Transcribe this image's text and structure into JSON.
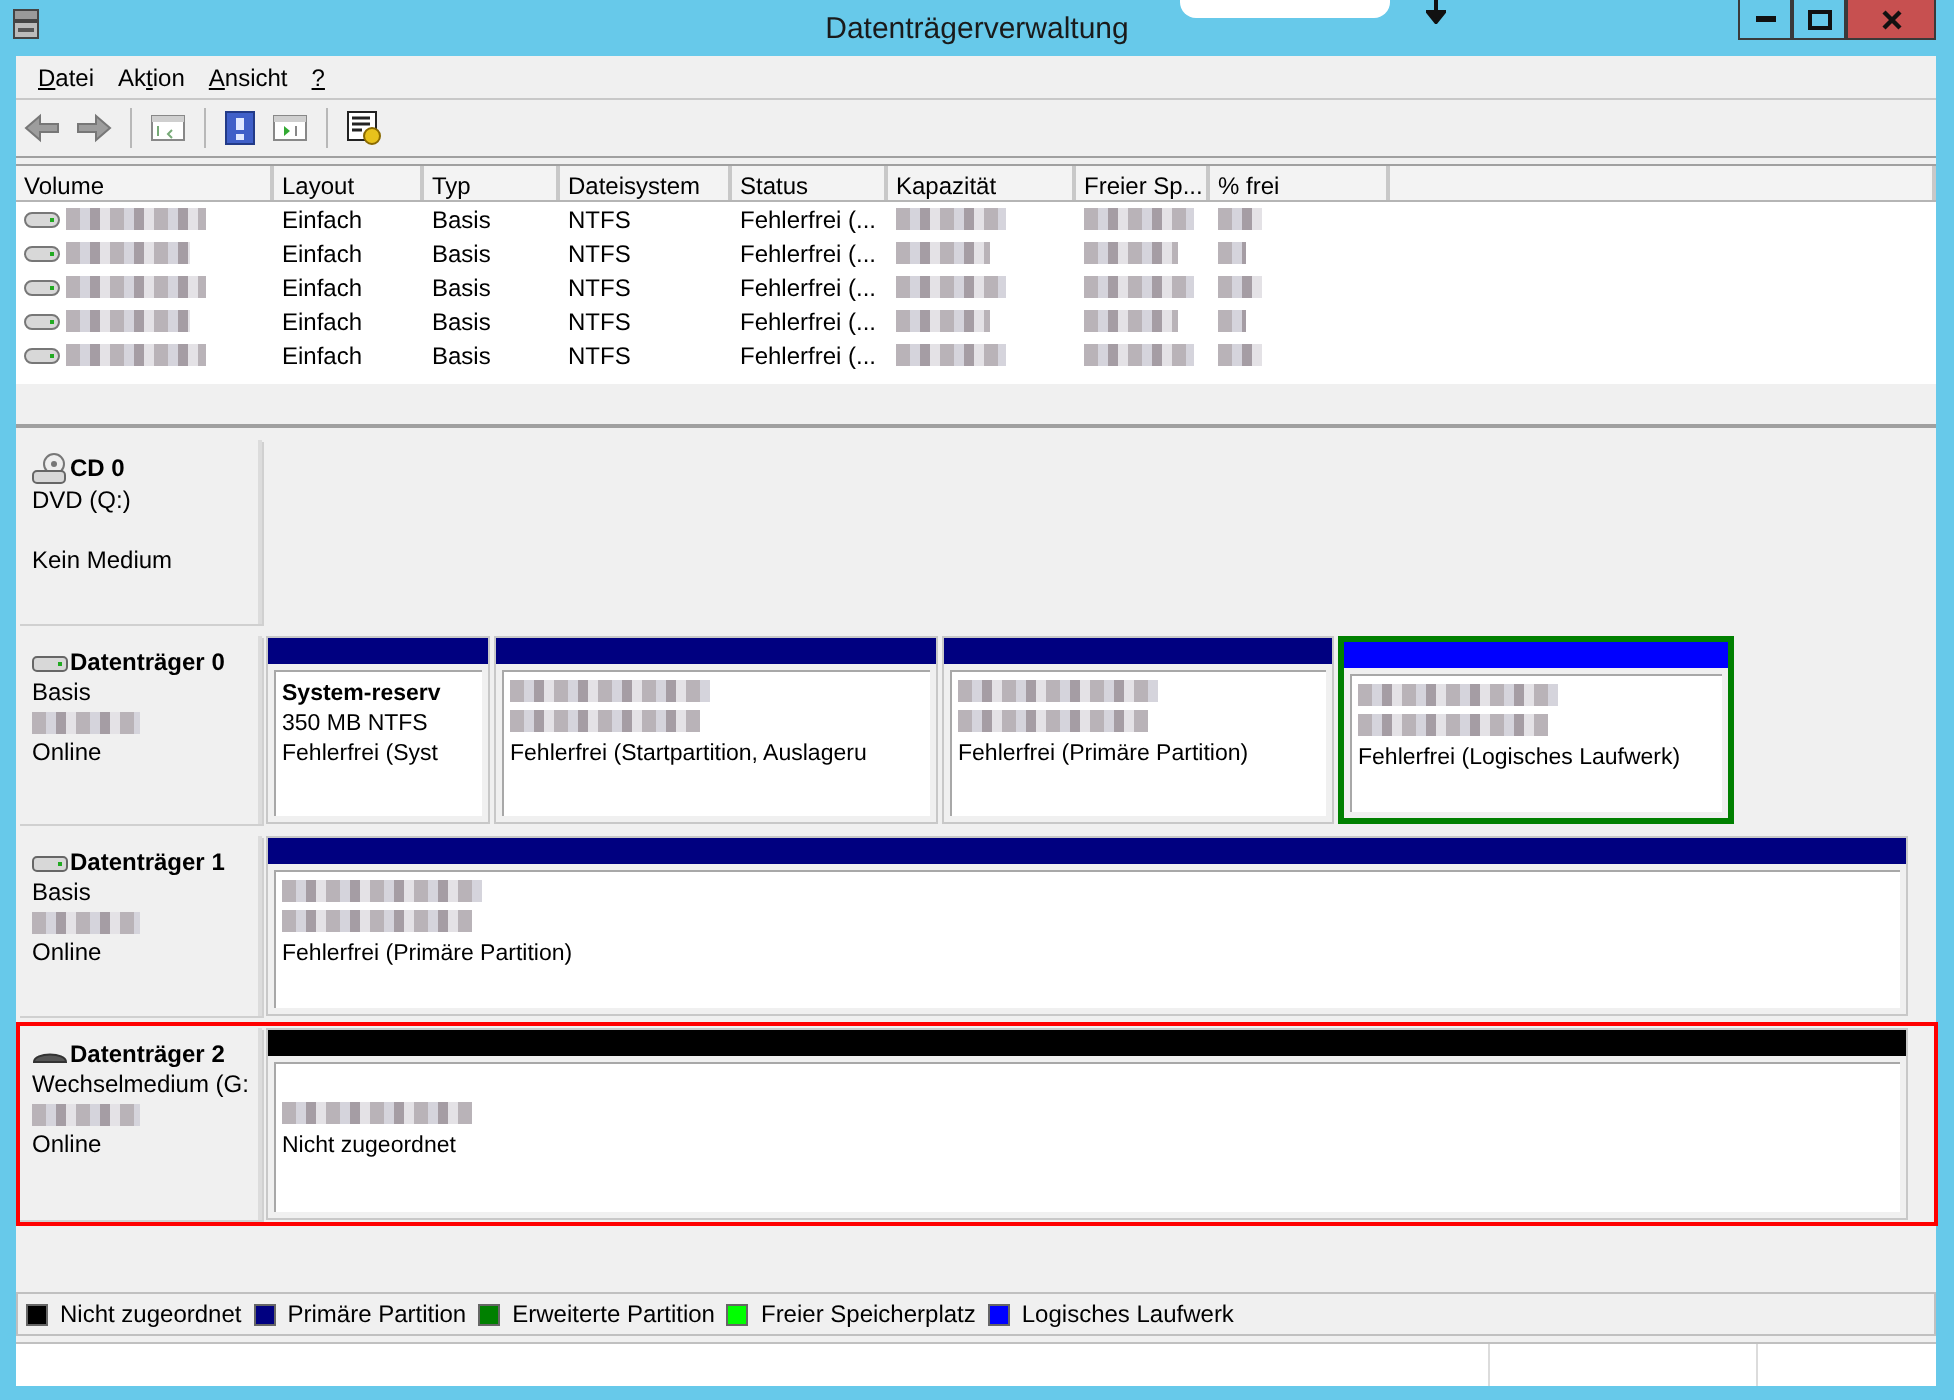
{
  "window": {
    "title": "Datenträgerverwaltung"
  },
  "menu": [
    {
      "accel": "D",
      "after": "atei"
    },
    {
      "before": "Ak",
      "accel": "t",
      "after": "ion"
    },
    {
      "accel": "A",
      "after": "nsicht"
    },
    {
      "accel": "?"
    }
  ],
  "volume_table": {
    "columns": [
      "Volume",
      "Layout",
      "Typ",
      "Dateisystem",
      "Status",
      "Kapazität",
      "Freier Sp...",
      "% frei"
    ],
    "rows": [
      {
        "cells": [
          {
            "kind": "redacted"
          },
          "Einfach",
          "Basis",
          "NTFS",
          "Fehlerfrei (...",
          {
            "kind": "redacted"
          },
          {
            "kind": "redacted"
          },
          {
            "kind": "redacted"
          }
        ]
      },
      {
        "cells": [
          {
            "kind": "redacted"
          },
          "Einfach",
          "Basis",
          "NTFS",
          "Fehlerfrei (...",
          {
            "kind": "redacted"
          },
          {
            "kind": "redacted"
          },
          {
            "kind": "redacted"
          }
        ]
      },
      {
        "cells": [
          {
            "kind": "redacted"
          },
          "Einfach",
          "Basis",
          "NTFS",
          "Fehlerfrei (...",
          {
            "kind": "redacted"
          },
          {
            "kind": "redacted"
          },
          {
            "kind": "redacted"
          }
        ]
      },
      {
        "cells": [
          {
            "kind": "redacted"
          },
          "Einfach",
          "Basis",
          "NTFS",
          "Fehlerfrei (...",
          {
            "kind": "redacted"
          },
          {
            "kind": "redacted"
          },
          {
            "kind": "redacted"
          }
        ]
      },
      {
        "cells": [
          {
            "kind": "redacted"
          },
          "Einfach",
          "Basis",
          "NTFS",
          "Fehlerfrei (...",
          {
            "kind": "redacted"
          },
          {
            "kind": "redacted"
          },
          {
            "kind": "redacted"
          }
        ]
      }
    ]
  },
  "disks": [
    {
      "kind": "cdrom",
      "name": "CD 0",
      "type": "DVD (Q:)",
      "status": "Kein Medium",
      "highlighted": false
    },
    {
      "kind": "hdd",
      "name": "Datenträger 0",
      "type": "Basis",
      "size": {
        "kind": "redacted"
      },
      "status": "Online",
      "highlighted": false,
      "partitions": [
        {
          "kind": "primary",
          "name": "System-reserv",
          "size": "350 MB NTFS",
          "status": "Fehlerfrei (Syst"
        },
        {
          "kind": "primary",
          "name": {
            "kind": "redacted"
          },
          "size": {
            "kind": "redacted"
          },
          "status": "Fehlerfrei (Startpartition, Auslageru"
        },
        {
          "kind": "primary",
          "name": {
            "kind": "redacted"
          },
          "size": {
            "kind": "redacted"
          },
          "status": "Fehlerfrei (Primäre Partition)"
        },
        {
          "kind": "logical",
          "name": {
            "kind": "redacted"
          },
          "size": {
            "kind": "redacted"
          },
          "status": "Fehlerfrei (Logisches Laufwerk)"
        }
      ]
    },
    {
      "kind": "hdd",
      "name": "Datenträger 1",
      "type": "Basis",
      "size": {
        "kind": "redacted"
      },
      "status": "Online",
      "highlighted": false,
      "partitions": [
        {
          "kind": "primary",
          "name": {
            "kind": "redacted"
          },
          "size": {
            "kind": "redacted"
          },
          "status": "Fehlerfrei (Primäre Partition)"
        }
      ]
    },
    {
      "kind": "removable",
      "name": "Datenträger 2",
      "type": "Wechselmedium (G:",
      "size": {
        "kind": "redacted"
      },
      "status": "Online",
      "highlighted": true,
      "partitions": [
        {
          "kind": "unallocated",
          "size": {
            "kind": "redacted"
          },
          "status": "Nicht zugeordnet"
        }
      ]
    }
  ],
  "legend": [
    {
      "label": "Nicht zugeordnet",
      "color": "#000000"
    },
    {
      "label": "Primäre Partition",
      "color": "#000080"
    },
    {
      "label": "Erweiterte Partition",
      "color": "#008000"
    },
    {
      "label": "Freier Speicherplatz",
      "color": "#00ff00"
    },
    {
      "label": "Logisches Laufwerk",
      "color": "#0000ff"
    }
  ]
}
